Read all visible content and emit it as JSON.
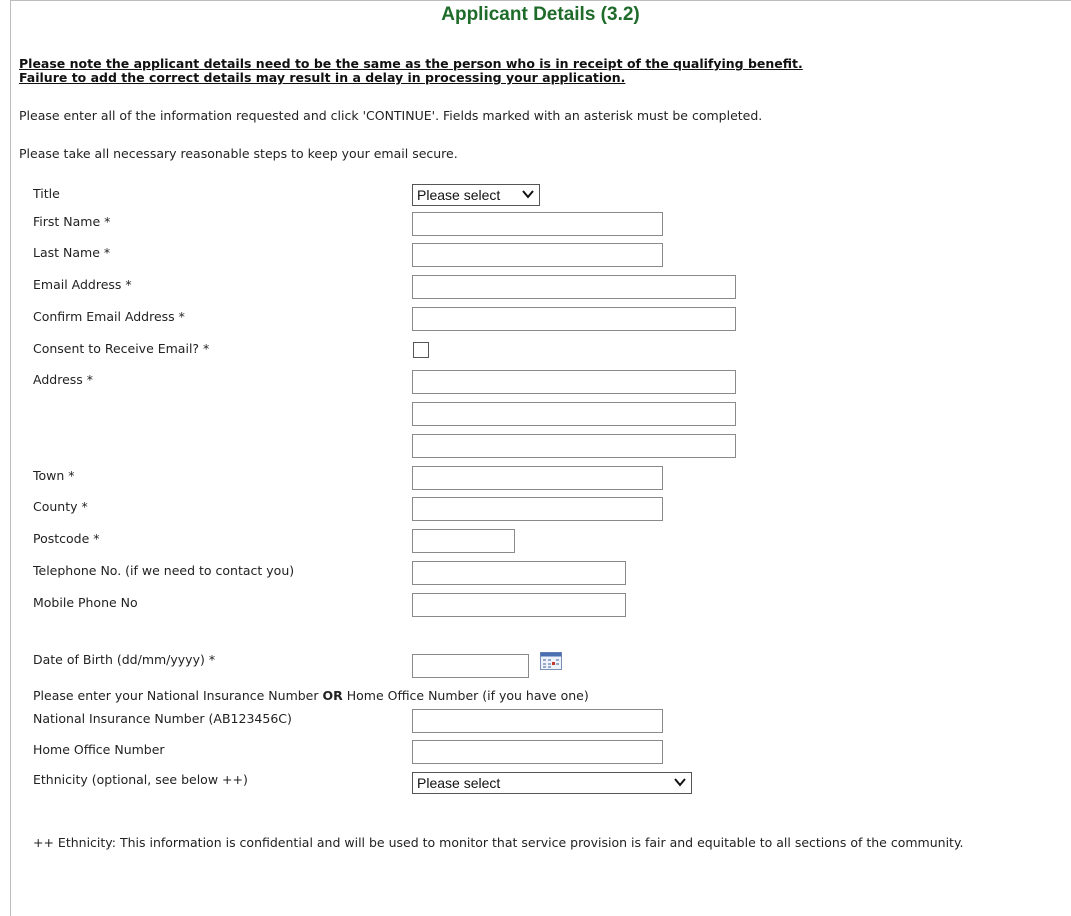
{
  "page_title": "Applicant Details (3.2)",
  "notice": {
    "line1": "Please note the applicant details need to be the same as the person who is in receipt of the qualifying benefit.",
    "line2": "Failure to add the correct details may result in a delay in processing your application."
  },
  "instructions": "Please enter all of the information requested and click 'CONTINUE'. Fields marked with an asterisk must be completed.",
  "security_note": "Please take all necessary reasonable steps to keep your email secure.",
  "fields": {
    "title": {
      "label": "Title",
      "selected": "Please select"
    },
    "first_name": {
      "label": "First Name *",
      "value": ""
    },
    "last_name": {
      "label": "Last Name *",
      "value": ""
    },
    "email": {
      "label": "Email Address *",
      "value": ""
    },
    "confirm_email": {
      "label": "Confirm Email Address *",
      "value": ""
    },
    "consent_email": {
      "label": "Consent to Receive Email? *",
      "checked": false
    },
    "address": {
      "label": "Address *",
      "line1": "",
      "line2": "",
      "line3": ""
    },
    "town": {
      "label": "Town *",
      "value": ""
    },
    "county": {
      "label": "County *",
      "value": ""
    },
    "postcode": {
      "label": "Postcode *",
      "value": ""
    },
    "telephone": {
      "label": "Telephone No. (if we need to contact you)",
      "value": ""
    },
    "mobile": {
      "label": "Mobile Phone No",
      "value": ""
    },
    "dob": {
      "label": "Date of Birth (dd/mm/yyyy) *",
      "value": ""
    },
    "ni_or_ho_prompt": {
      "before": "Please enter your National Insurance Number ",
      "bold": "OR",
      "after": " Home Office Number (if you have one)"
    },
    "ni_number": {
      "label": "National Insurance Number (AB123456C)",
      "value": ""
    },
    "home_office": {
      "label": "Home Office Number",
      "value": ""
    },
    "ethnicity": {
      "label": "Ethnicity (optional, see below ++)",
      "selected": "Please select"
    }
  },
  "footnote": "++ Ethnicity: This information is confidential and will be used to monitor that service provision is fair and equitable to all sections of the community."
}
